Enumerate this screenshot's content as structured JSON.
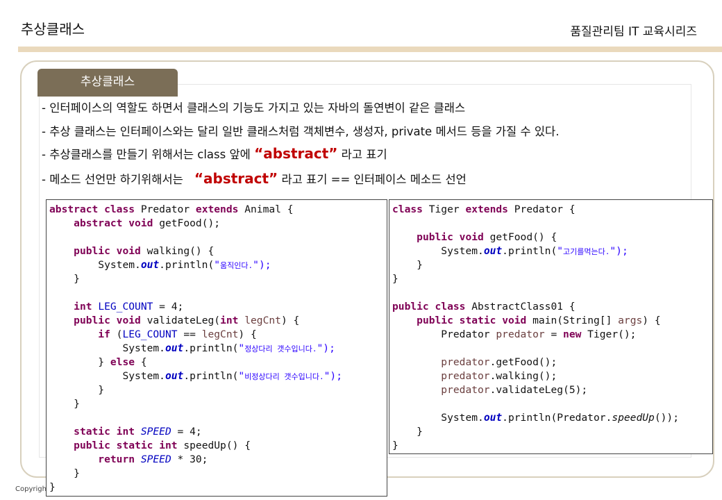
{
  "header": {
    "title": "추상클래스",
    "series": "품질관리팀 IT 교육시리즈"
  },
  "tab": {
    "label": "추상클래스"
  },
  "bullets": [
    {
      "text": "- 인터페이스의 역할도 하면서 클래스의 기능도 가지고 있는 자바의 돌연변이 같은 클래스"
    },
    {
      "text": "- 추상 클래스는 인터페이스와는 달리 일반 클래스처럼 객체변수, 생성자, private 메서드 등을 가질 수 있다."
    },
    {
      "before": "- 추상클래스를 만들기 위해서는 class 앞에 ",
      "highlight": "“abstract”",
      "after": " 라고 표기"
    },
    {
      "before": "- 메소드 선언만 하기위해서는",
      "highlight": "“abstract”",
      "after": " 라고 표기 == 인터페이스 메소드 선언"
    }
  ],
  "code_left": {
    "l1": {
      "a": "abstract",
      "b": "class",
      "c": " Predator ",
      "d": "extends",
      "e": " Animal {"
    },
    "l2": {
      "a": "abstract",
      "b": "void",
      "c": " getFood();"
    },
    "l4": {
      "a": "public",
      "b": "void",
      "c": " walking() {"
    },
    "l5": {
      "a": "System.",
      "b": "out",
      "c": ".println(",
      "d": "\"",
      "e": "움직인다.",
      "f": "\");"
    },
    "l6": "}",
    "l8": {
      "a": "int",
      "b": "LEG_COUNT",
      "c": " = 4;"
    },
    "l9": {
      "a": "public",
      "b": "void",
      "c": " validateLeg(",
      "d": "int",
      "e": "legCnt",
      "f": ") {"
    },
    "l10": {
      "a": "if",
      "b": " (",
      "c": "LEG_COUNT",
      "d": " == ",
      "e": "legCnt",
      "f": ") {"
    },
    "l11": {
      "a": "System.",
      "b": "out",
      "c": ".println(",
      "d": "\"",
      "e": "정상다리 갯수입니다.",
      "f": "\");"
    },
    "l12": {
      "a": "} ",
      "b": "else",
      "c": " {"
    },
    "l13": {
      "a": "System.",
      "b": "out",
      "c": ".println(",
      "d": "\"",
      "e": "비정상다리 갯수입니다.",
      "f": "\");"
    },
    "l14": "}",
    "l15": "}",
    "l17": {
      "a": "static",
      "b": "int",
      "c": "SPEED",
      "d": " = 4;"
    },
    "l18": {
      "a": "public",
      "b": "static",
      "c": "int",
      "d": " speedUp() {"
    },
    "l19": {
      "a": "return",
      "b": "SPEED",
      "c": " * 30;"
    },
    "l20": "}",
    "l21": "}"
  },
  "code_right": {
    "r1": {
      "a": "class",
      "b": " Tiger ",
      "c": "extends",
      "d": " Predator {"
    },
    "r3": {
      "a": "public",
      "b": "void",
      "c": " getFood() {"
    },
    "r4": {
      "a": "System.",
      "b": "out",
      "c": ".println(",
      "d": "\"",
      "e": "고기를먹는다.",
      "f": "\");"
    },
    "r5": "}",
    "r6": "}",
    "r8": {
      "a": "public",
      "b": "class",
      "c": " AbstractClass01 {"
    },
    "r9": {
      "a": "public",
      "b": "static",
      "c": "void",
      "d": " main(String[] ",
      "e": "args",
      "f": ") {"
    },
    "r10": {
      "a": "Predator ",
      "b": "predator",
      "c": " = ",
      "d": "new",
      "e": " Tiger();"
    },
    "r12": {
      "a": "predator",
      "b": ".getFood();"
    },
    "r13": {
      "a": "predator",
      "b": ".walking();"
    },
    "r14": {
      "a": "predator",
      "b": ".validateLeg(5);"
    },
    "r16": {
      "a": "System.",
      "b": "out",
      "c": ".println(Predator.",
      "d": "speedUp",
      "e": "());"
    },
    "r17": "}",
    "r18": "}"
  },
  "footer": {
    "copyright": "Copyrigh"
  }
}
